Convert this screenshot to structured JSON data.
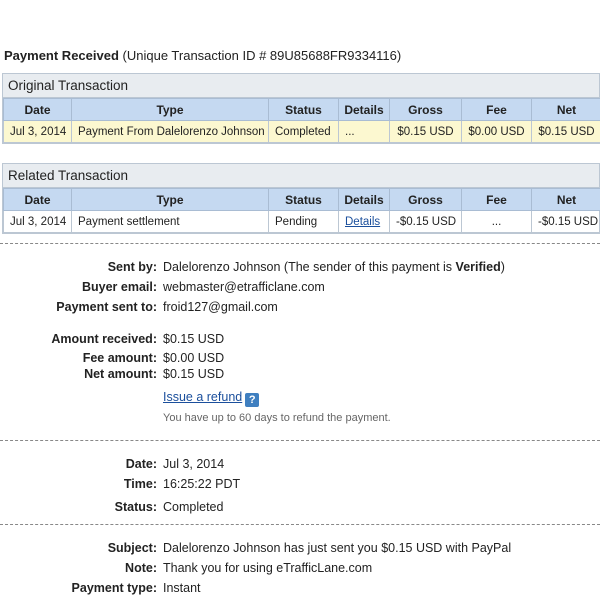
{
  "header": {
    "title_bold": "Payment Received",
    "title_rest": " (Unique Transaction ID # 89U85688FR9334116)"
  },
  "original": {
    "title": "Original Transaction",
    "columns": [
      "Date",
      "Type",
      "Status",
      "Details",
      "Gross",
      "Fee",
      "Net"
    ],
    "row": {
      "date": "Jul 3, 2014",
      "type": "Payment From Dalelorenzo Johnson",
      "status": "Completed",
      "details": "...",
      "gross": "$0.15 USD",
      "fee": "$0.00 USD",
      "net": "$0.15 USD"
    }
  },
  "related": {
    "title": "Related Transaction",
    "columns": [
      "Date",
      "Type",
      "Status",
      "Details",
      "Gross",
      "Fee",
      "Net"
    ],
    "row": {
      "date": "Jul 3, 2014",
      "type": "Payment settlement",
      "status": "Pending",
      "details": "Details",
      "gross": "-$0.15 USD",
      "fee": "...",
      "net": "-$0.15 USD"
    }
  },
  "info": {
    "sent_by_label": "Sent by:",
    "sent_by_name": "Dalelorenzo Johnson",
    "sent_by_note_pre": " (The sender of this payment is ",
    "sent_by_note_bold": "Verified",
    "sent_by_note_post": ")",
    "buyer_email_label": "Buyer email:",
    "buyer_email": "webmaster@etrafficlane.com",
    "sent_to_label": "Payment sent to:",
    "sent_to": "froid127@gmail.com",
    "amount_label": "Amount received:",
    "amount": "$0.15 USD",
    "fee_label": "Fee amount:",
    "fee": "$0.00 USD",
    "net_label": "Net amount:",
    "net": "$0.15 USD",
    "refund_link": "Issue a refund",
    "refund_help": "?",
    "refund_note": "You have up to 60 days to refund the payment.",
    "date_label": "Date:",
    "date": "Jul 3, 2014",
    "time_label": "Time:",
    "time": "16:25:22 PDT",
    "status_label": "Status:",
    "status": "Completed",
    "subject_label": "Subject:",
    "subject": "Dalelorenzo Johnson has just sent you $0.15 USD with PayPal",
    "note_label": "Note:",
    "note": "Thank you for using eTrafficLane.com",
    "payment_type_label": "Payment type:",
    "payment_type": "Instant"
  }
}
